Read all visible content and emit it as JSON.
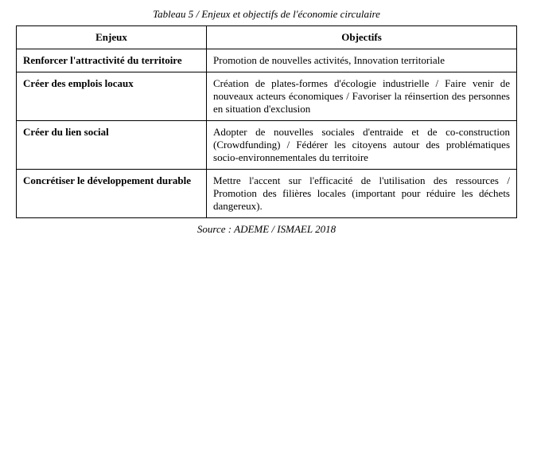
{
  "title": "Tableau 5 / Enjeux et objectifs de l'économie circulaire",
  "headers": {
    "enjeux": "Enjeux",
    "objectifs": "Objectifs"
  },
  "rows": [
    {
      "enjeux": "Renforcer l'attractivité du territoire",
      "objectifs": "Promotion de nouvelles activités, Innovation territoriale"
    },
    {
      "enjeux": "Créer des emplois locaux",
      "objectifs": "Création de plates-formes d'écologie industrielle / Faire venir de nouveaux acteurs économiques / Favoriser la réinsertion des personnes en situation d'exclusion"
    },
    {
      "enjeux": "Créer du lien social",
      "objectifs": "Adopter de nouvelles sociales d'entraide et de co-construction (Crowdfunding) / Fédérer les citoyens autour des problématiques socio-environnementales du territoire"
    },
    {
      "enjeux": "Concrétiser le développement durable",
      "objectifs": "Mettre l'accent sur l'efficacité de l'utilisation des ressources / Promotion des filières locales (important pour réduire les déchets dangereux)."
    }
  ],
  "source": "Source : ADEME / ISMAEL 2018"
}
